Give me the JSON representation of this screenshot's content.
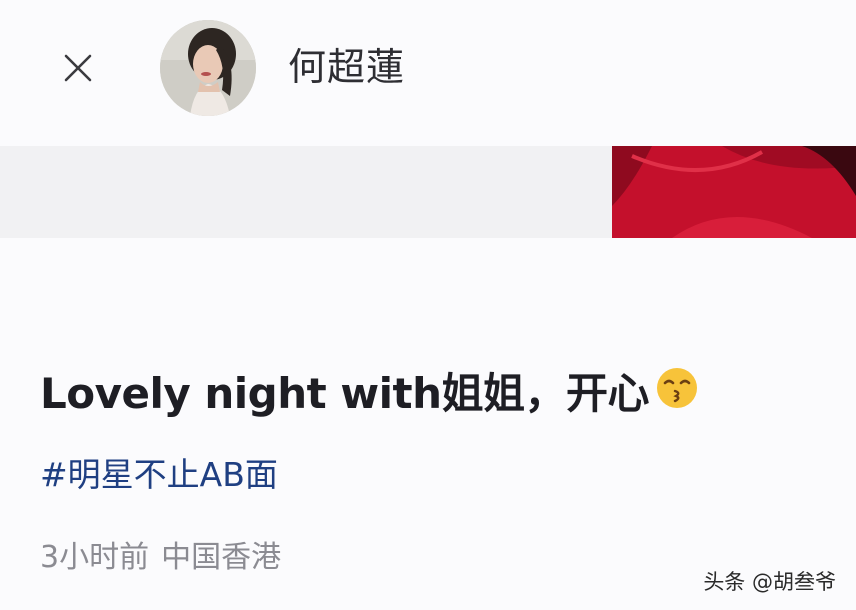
{
  "header": {
    "close_icon": "close-icon",
    "username": "何超蓮"
  },
  "post": {
    "text": "Lovely night with姐姐，开心",
    "emoji": "kissing-face-emoji",
    "hashtag": "#明星不止AB面",
    "time": "3小时前",
    "location": "中国香港"
  },
  "watermark": "头条 @胡叁爷",
  "colors": {
    "hashtag": "#1f3f82",
    "meta": "#8b8b92",
    "image_red": "#c4102c"
  }
}
